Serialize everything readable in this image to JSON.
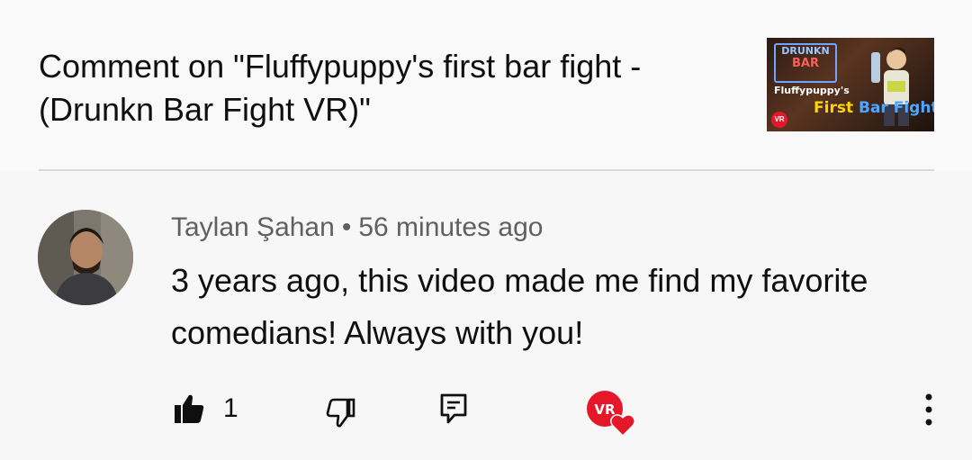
{
  "header": {
    "title": "Comment on \"Fluffypuppy's first bar fight - (Drunkn Bar Fight VR)\"",
    "thumbnail": {
      "logo_line1": "DRUNKN",
      "logo_line2": "BAR",
      "name": "Fluffypuppy's",
      "first": "First",
      "bar_fight": "Bar Fight!",
      "badge": "VR"
    }
  },
  "comment": {
    "author": "Taylan Şahan",
    "separator": "•",
    "time": "56 minutes ago",
    "text": "3 years ago, this video made me find my favorite comedians! Always with you!",
    "like_count": "1",
    "creator_badge": "VR"
  },
  "icons": {
    "like": "thumbs-up-filled-icon",
    "dislike": "thumbs-down-icon",
    "reply": "reply-comment-icon",
    "creator_heart": "creator-heart-icon",
    "more": "more-vertical-icon"
  },
  "colors": {
    "text_primary": "#0f0f0f",
    "text_secondary": "#606060",
    "heart": "#e5182a"
  }
}
